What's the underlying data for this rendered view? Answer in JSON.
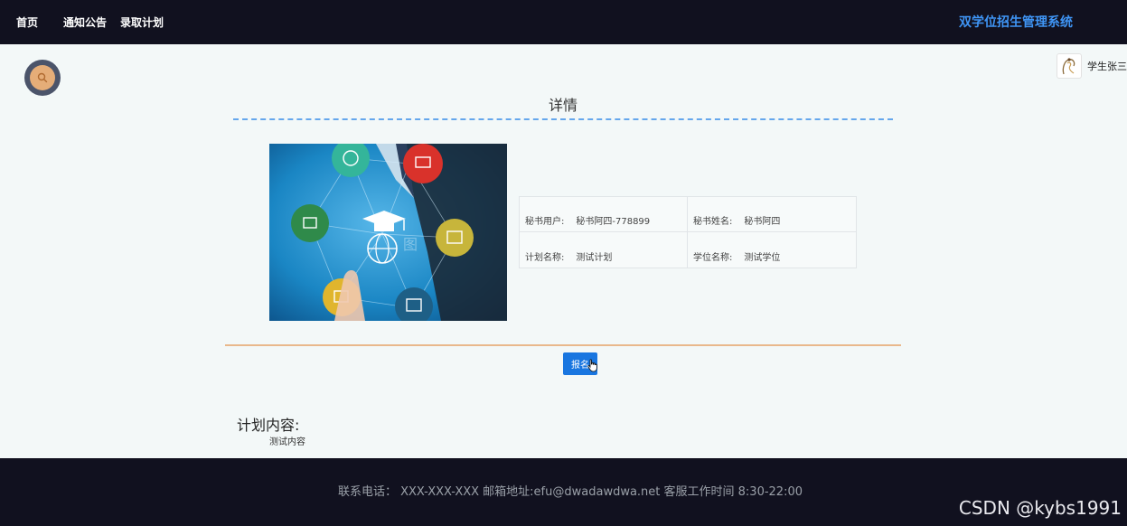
{
  "nav": {
    "items": [
      {
        "label": "首页"
      },
      {
        "label": "通知公告"
      },
      {
        "label": "录取计划"
      }
    ],
    "brand": "双学位招生管理系统"
  },
  "search": {
    "icon": "search-icon"
  },
  "user": {
    "name": "学生张三",
    "icon": "avatar-icon"
  },
  "detail": {
    "title": "详情",
    "image_icon": "graduation-network-icon",
    "image_caption": "图",
    "fields": [
      {
        "key": "秘书用户:",
        "value": "秘书阿四-778899"
      },
      {
        "key": "秘书姓名:",
        "value": "秘书阿四"
      },
      {
        "key": "计划名称:",
        "value": "测试计划"
      },
      {
        "key": "学位名称:",
        "value": "测试学位"
      }
    ],
    "signup_label": "报名"
  },
  "plan_content": {
    "label": "计划内容:",
    "value": "测试内容"
  },
  "footer": {
    "text": "联系电话： XXX-XXX-XXX 邮箱地址:efu@dwadawdwa.net 客服工作时间 8:30-22:00",
    "watermark": "CSDN @kybs1991"
  },
  "colors": {
    "topbar": "#11111f",
    "brand": "#3f95f5",
    "accent_button": "#1976e0",
    "dash_line": "#65a7ec",
    "divider": "#e9b88c"
  }
}
